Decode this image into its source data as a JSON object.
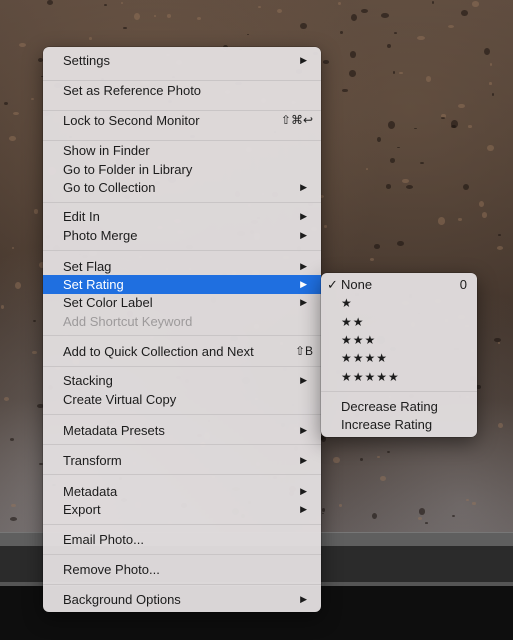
{
  "main_menu": {
    "items": [
      {
        "label": "Settings",
        "submenu": true
      },
      {
        "label": "Set as Reference Photo"
      },
      {
        "label": "Lock to Second Monitor",
        "shortcut": "⇧⌘↩"
      },
      {
        "label": "Show in Finder"
      },
      {
        "label": "Go to Folder in Library"
      },
      {
        "label": "Go to Collection",
        "submenu": true
      },
      {
        "label": "Edit In",
        "submenu": true
      },
      {
        "label": "Photo Merge",
        "submenu": true
      },
      {
        "label": "Set Flag",
        "submenu": true
      },
      {
        "label": "Set Rating",
        "submenu": true,
        "highlighted": true
      },
      {
        "label": "Set Color Label",
        "submenu": true
      },
      {
        "label": "Add Shortcut Keyword",
        "disabled": true
      },
      {
        "label": "Add to Quick Collection and Next",
        "shortcut": "⇧B"
      },
      {
        "label": "Stacking",
        "submenu": true
      },
      {
        "label": "Create Virtual Copy"
      },
      {
        "label": "Metadata Presets",
        "submenu": true
      },
      {
        "label": "Transform",
        "submenu": true
      },
      {
        "label": "Metadata",
        "submenu": true
      },
      {
        "label": "Export",
        "submenu": true
      },
      {
        "label": "Email Photo..."
      },
      {
        "label": "Remove Photo..."
      },
      {
        "label": "Background Options",
        "submenu": true
      }
    ],
    "submenu_arrow": "▶"
  },
  "rating_submenu": {
    "checkmark": "✓",
    "items": [
      {
        "label": "None",
        "shortcut": "0",
        "checked": true
      },
      {
        "label": "★"
      },
      {
        "label": "★★"
      },
      {
        "label": "★★★"
      },
      {
        "label": "★★★★"
      },
      {
        "label": "★★★★★"
      },
      {
        "label": "Decrease Rating"
      },
      {
        "label": "Increase Rating"
      }
    ]
  },
  "colors": {
    "highlight": "#1f6fe0",
    "menu_background": "#e2dedf",
    "disabled_text": "#9d9a9b"
  }
}
